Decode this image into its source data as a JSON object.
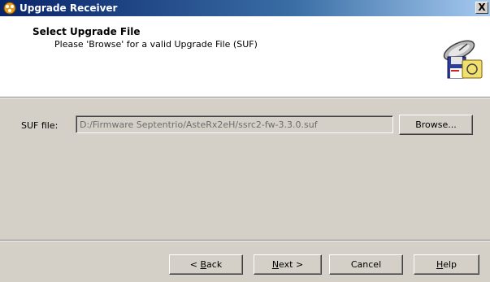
{
  "window": {
    "title": "Upgrade Receiver",
    "close_label": "X"
  },
  "header": {
    "title": "Select Upgrade File",
    "subtitle": "Please 'Browse' for a valid Upgrade File (SUF)"
  },
  "form": {
    "suf_label": "SUF file:",
    "suf_value": "D:/Firmware Septentrio/AsteRx2eH/ssrc2-fw-3.3.0.suf",
    "browse_label": "Browse..."
  },
  "footer": {
    "back": {
      "prefix": "< ",
      "accel": "B",
      "rest": "ack"
    },
    "next": {
      "accel": "N",
      "rest": "ext >"
    },
    "cancel": "Cancel",
    "help": {
      "accel": "H",
      "rest": "elp"
    }
  },
  "colors": {
    "title_gradient_start": "#0a246a",
    "title_gradient_end": "#a6caf0",
    "face": "#d4d0c8",
    "header_bg": "#ffffff",
    "disabled_text": "#6d6d6d"
  },
  "icons": {
    "app": "upgrade-receiver-app-icon",
    "wizard": "satellite-dish-floppy-disk-icon",
    "close": "close-icon"
  }
}
